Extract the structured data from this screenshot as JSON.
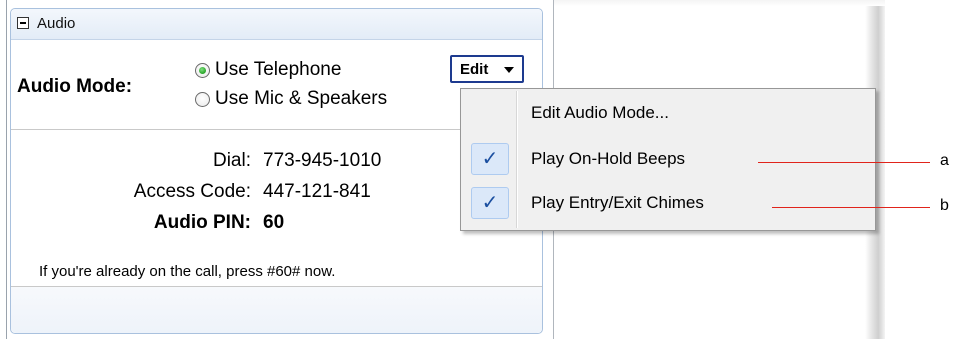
{
  "panel": {
    "title": "Audio",
    "audio_mode_label": "Audio Mode:",
    "radio_options": [
      {
        "label": "Use Telephone",
        "checked": true
      },
      {
        "label": "Use Mic & Speakers",
        "checked": false
      }
    ],
    "edit_button_label": "Edit",
    "dial_label": "Dial:",
    "dial_value": "773-945-1010",
    "access_code_label": "Access Code:",
    "access_code_value": "447-121-841",
    "audio_pin_label": "Audio PIN:",
    "audio_pin_value": "60",
    "note": "If you're already on the call, press #60# now."
  },
  "menu": {
    "items": [
      {
        "label": "Edit Audio Mode...",
        "checked": false
      },
      {
        "label": "Play On-Hold Beeps",
        "checked": true
      },
      {
        "label": "Play Entry/Exit Chimes",
        "checked": true
      }
    ],
    "check_glyph": "✓"
  },
  "callouts": {
    "a": "a",
    "b": "b"
  },
  "colors": {
    "callout_line": "#e0241b",
    "edit_button_border": "#1d3a8f",
    "radio_selected": "#1a9a1a"
  }
}
